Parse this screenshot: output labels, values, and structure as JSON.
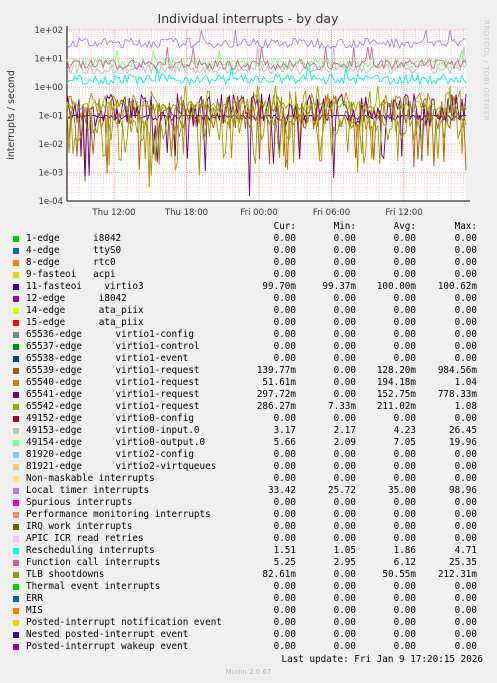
{
  "side_credit": "RRDTOOL / TOBI OETIKER",
  "footer": {
    "last_update": "Last update: Fri Jan  9 17:20:15 2026",
    "munin_version": "Munin 2.0.67"
  },
  "legend_headers": {
    "cur": "Cur:",
    "min": "Min:",
    "avg": "Avg:",
    "max": "Max:"
  },
  "chart_data": {
    "type": "line",
    "title": "Individual interrupts - by day",
    "ylabel": "interrupts / second",
    "yscale": "log",
    "ylim": [
      0.0001,
      100
    ],
    "y_ticks": [
      "1e+02",
      "1e+01",
      "1e+00",
      "1e-01",
      "1e-02",
      "1e-03",
      "1e-04"
    ],
    "x_ticks": [
      "Thu 12:00",
      "Thu 18:00",
      "Fri 00:00",
      "Fri 06:00",
      "Fri 12:00"
    ],
    "grid": true,
    "series": [
      {
        "name": "1-edge      i8042",
        "color": "#00cc00",
        "cur": "0.00",
        "min": "0.00",
        "avg": "0.00",
        "max": "0.00"
      },
      {
        "name": "4-edge      ttyS0",
        "color": "#0066b3",
        "cur": "0.00",
        "min": "0.00",
        "avg": "0.00",
        "max": "0.00"
      },
      {
        "name": "8-edge      rtc0",
        "color": "#ff8000",
        "cur": "0.00",
        "min": "0.00",
        "avg": "0.00",
        "max": "0.00"
      },
      {
        "name": "9-fasteoi   acpi",
        "color": "#ffcc00",
        "cur": "0.00",
        "min": "0.00",
        "avg": "0.00",
        "max": "0.00"
      },
      {
        "name": "11-fasteoi    virtio3",
        "color": "#330099",
        "cur": "99.70m",
        "min": "99.37m",
        "avg": "100.00m",
        "max": "100.62m"
      },
      {
        "name": "12-edge      i8042",
        "color": "#990099",
        "cur": "0.00",
        "min": "0.00",
        "avg": "0.00",
        "max": "0.00"
      },
      {
        "name": "14-edge      ata_piix",
        "color": "#ccff00",
        "cur": "0.00",
        "min": "0.00",
        "avg": "0.00",
        "max": "0.00"
      },
      {
        "name": "15-edge      ata_piix",
        "color": "#ff0000",
        "cur": "0.00",
        "min": "0.00",
        "avg": "0.00",
        "max": "0.00"
      },
      {
        "name": "65536-edge      virtio1-config",
        "color": "#808080",
        "cur": "0.00",
        "min": "0.00",
        "avg": "0.00",
        "max": "0.00"
      },
      {
        "name": "65537-edge      virtio1-control",
        "color": "#008f00",
        "cur": "0.00",
        "min": "0.00",
        "avg": "0.00",
        "max": "0.00"
      },
      {
        "name": "65538-edge      virtio1-event",
        "color": "#00487d",
        "cur": "0.00",
        "min": "0.00",
        "avg": "0.00",
        "max": "0.00"
      },
      {
        "name": "65539-edge      virtio1-request",
        "color": "#b35a00",
        "cur": "139.77m",
        "min": "0.00",
        "avg": "128.20m",
        "max": "984.56m"
      },
      {
        "name": "65540-edge      virtio1-request",
        "color": "#b38f00",
        "cur": "51.61m",
        "min": "0.00",
        "avg": "194.18m",
        "max": "1.04"
      },
      {
        "name": "65541-edge      virtio1-request",
        "color": "#6b006b",
        "cur": "297.72m",
        "min": "0.00",
        "avg": "152.75m",
        "max": "778.33m"
      },
      {
        "name": "65542-edge      virtio1-request",
        "color": "#8fb300",
        "cur": "286.27m",
        "min": "7.33m",
        "avg": "211.02m",
        "max": "1.08"
      },
      {
        "name": "49152-edge      virtio0-config",
        "color": "#b30000",
        "cur": "0.00",
        "min": "0.00",
        "avg": "0.00",
        "max": "0.00"
      },
      {
        "name": "49153-edge      virtio0-input.0",
        "color": "#bebebe",
        "cur": "3.17",
        "min": "2.17",
        "avg": "4.23",
        "max": "26.45"
      },
      {
        "name": "49154-edge      virtio0-output.0",
        "color": "#80ff80",
        "cur": "5.66",
        "min": "2.09",
        "avg": "7.05",
        "max": "19.96"
      },
      {
        "name": "81920-edge      virtio2-config",
        "color": "#80c9ff",
        "cur": "0.00",
        "min": "0.00",
        "avg": "0.00",
        "max": "0.00"
      },
      {
        "name": "81921-edge      virtio2-virtqueues",
        "color": "#ffc080",
        "cur": "0.00",
        "min": "0.00",
        "avg": "0.00",
        "max": "0.00"
      },
      {
        "name": "Non-maskable interrupts",
        "color": "#ffe680",
        "cur": "0.00",
        "min": "0.00",
        "avg": "0.00",
        "max": "0.00"
      },
      {
        "name": "Local timer interrupts",
        "color": "#aa80ff",
        "cur": "33.42",
        "min": "25.72",
        "avg": "35.00",
        "max": "98.96"
      },
      {
        "name": "Spurious interrupts",
        "color": "#ee00cc",
        "cur": "0.00",
        "min": "0.00",
        "avg": "0.00",
        "max": "0.00"
      },
      {
        "name": "Performance monitoring interrupts",
        "color": "#ff8080",
        "cur": "0.00",
        "min": "0.00",
        "avg": "0.00",
        "max": "0.00"
      },
      {
        "name": "IRQ work interrupts",
        "color": "#666600",
        "cur": "0.00",
        "min": "0.00",
        "avg": "0.00",
        "max": "0.00"
      },
      {
        "name": "APIC ICR read retries",
        "color": "#ffbfff",
        "cur": "0.00",
        "min": "0.00",
        "avg": "0.00",
        "max": "0.00"
      },
      {
        "name": "Rescheduling interrupts",
        "color": "#00ffcc",
        "cur": "1.51",
        "min": "1.05",
        "avg": "1.86",
        "max": "4.71"
      },
      {
        "name": "Function call interrupts",
        "color": "#cc6699",
        "cur": "5.25",
        "min": "2.95",
        "avg": "6.12",
        "max": "25.35"
      },
      {
        "name": "TLB shootdowns",
        "color": "#999900",
        "cur": "82.61m",
        "min": "0.00",
        "avg": "50.55m",
        "max": "212.31m"
      },
      {
        "name": "Thermal event interrupts",
        "color": "#00cc00",
        "cur": "0.00",
        "min": "0.00",
        "avg": "0.00",
        "max": "0.00"
      },
      {
        "name": "ERR",
        "color": "#0066b3",
        "cur": "0.00",
        "min": "0.00",
        "avg": "0.00",
        "max": "0.00"
      },
      {
        "name": "MIS",
        "color": "#ff8000",
        "cur": "0.00",
        "min": "0.00",
        "avg": "0.00",
        "max": "0.00"
      },
      {
        "name": "Posted-interrupt notification event",
        "color": "#ffcc00",
        "cur": "0.00",
        "min": "0.00",
        "avg": "0.00",
        "max": "0.00"
      },
      {
        "name": "Nested posted-interrupt event",
        "color": "#330099",
        "cur": "0.00",
        "min": "0.00",
        "avg": "0.00",
        "max": "0.00"
      },
      {
        "name": "Posted-interrupt wakeup event",
        "color": "#990099",
        "cur": "0.00",
        "min": "0.00",
        "avg": "0.00",
        "max": "0.00"
      }
    ]
  }
}
